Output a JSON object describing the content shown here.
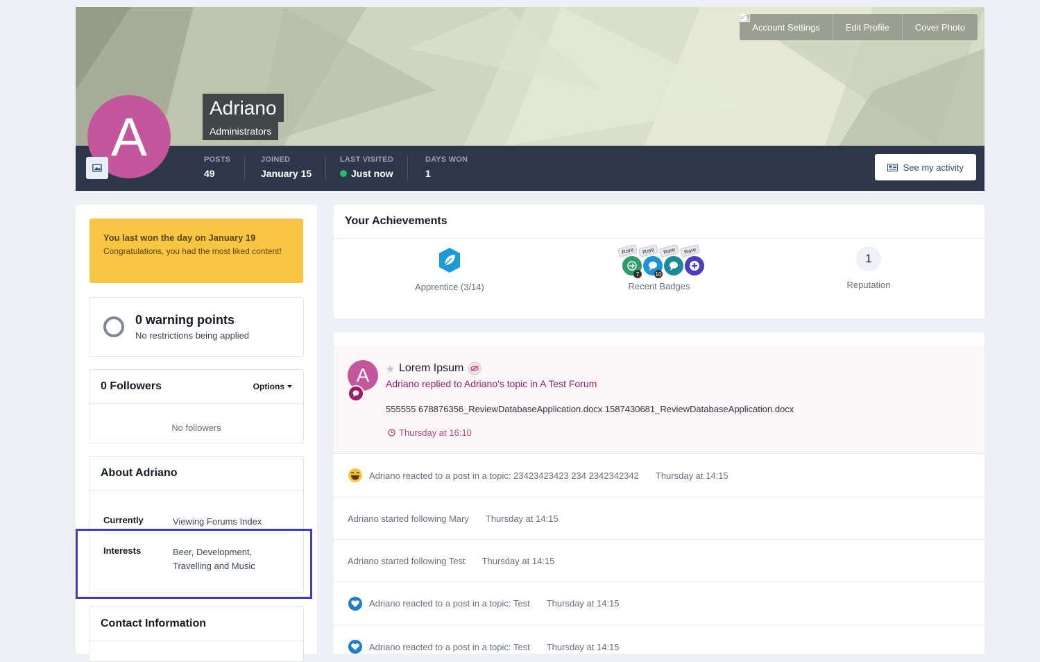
{
  "header": {
    "buttons": {
      "account_settings": "Account Settings",
      "edit_profile": "Edit Profile",
      "cover_photo": "Cover Photo"
    },
    "name": "Adriano",
    "group": "Administrators",
    "avatar_letter": "A",
    "stats": [
      {
        "label": "POSTS",
        "value": "49"
      },
      {
        "label": "JOINED",
        "value": "January 15"
      },
      {
        "label": "LAST VISITED",
        "value": "Just now"
      },
      {
        "label": "DAYS WON",
        "value": "1"
      }
    ],
    "see_activity": "See my activity"
  },
  "sidebar": {
    "day_won": {
      "title": "You last won the day on January 19",
      "text": "Congratulations, you had the most liked content!"
    },
    "warnings": {
      "title": "0 warning points",
      "subtitle": "No restrictions being applied"
    },
    "followers": {
      "title": "0 Followers",
      "options": "Options",
      "empty": "No followers"
    },
    "about": {
      "title": "About Adriano",
      "rows": [
        {
          "label": "Currently",
          "value": "Viewing Forums Index"
        },
        {
          "label": "Interests",
          "value": "Beer, Development, Travelling and Music"
        }
      ]
    },
    "contact": {
      "title": "Contact Information"
    }
  },
  "achievements": {
    "title": "Your Achievements",
    "rank": "Apprentice (3/14)",
    "recent_badges": "Recent Badges",
    "rare_label": "Rare",
    "badge_counts": [
      "7",
      "10"
    ],
    "reputation_value": "1",
    "reputation_label": "Reputation"
  },
  "stream": {
    "featured": {
      "avatar_letter": "A",
      "title": "Lorem Ipsum",
      "subtitle": "Adriano replied to Adriano's topic in A Test Forum",
      "body": "555555 678876356_ReviewDatabaseApplication.docx 1587430681_ReviewDatabaseApplication.docx",
      "time": "Thursday at 16:10"
    },
    "items": [
      {
        "text": "Adriano reacted to a post in a topic: 23423423423 234 2342342342",
        "time": "Thursday at 14:15"
      },
      {
        "text": "Adriano started following Mary",
        "time": "Thursday at 14:15"
      },
      {
        "text": "Adriano started following Test",
        "time": "Thursday at 14:15"
      },
      {
        "text": "Adriano reacted to a post in a topic: Test",
        "time": "Thursday at 14:15"
      },
      {
        "text": "Adriano reacted to a post in a topic: Test",
        "time": "Thursday at 14:15"
      }
    ]
  },
  "colors": {
    "accent": "#9b1d68",
    "avatar": "#c4569e",
    "stats_bar": "#2e3749",
    "day_won": "#f9c544",
    "highlight": "#3c3fc0"
  }
}
